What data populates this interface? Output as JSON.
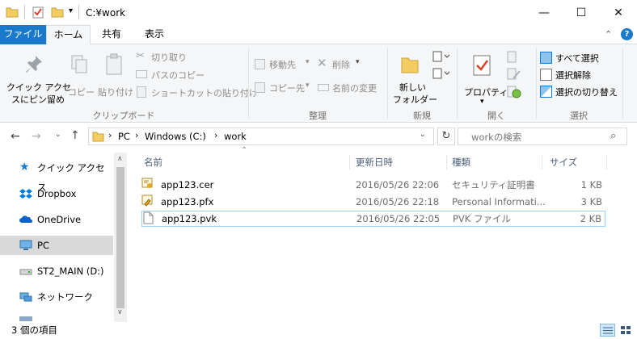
{
  "window": {
    "title": "C:¥work",
    "minimize": "—",
    "maximize": "☐",
    "close": "✕"
  },
  "tabs": {
    "file": "ファイル",
    "home": "ホーム",
    "share": "共有",
    "view": "表示"
  },
  "ribbon": {
    "quick_access": "クイック アクセ\nスにピン留め",
    "quick_access_l1": "クイック アクセ",
    "quick_access_l2": "スにピン留め",
    "copy": "コピー",
    "paste": "貼り付け",
    "cut": "切り取り",
    "copy_path": "パスのコピー",
    "paste_shortcut": "ショートカットの貼り付け",
    "clipboard_group": "クリップボード",
    "move_to": "移動先",
    "copy_to": "コピー先",
    "delete": "削除",
    "rename": "名前の変更",
    "organize_group": "整理",
    "new_folder_l1": "新しい",
    "new_folder_l2": "フォルダー",
    "new_group": "新規",
    "properties": "プロパティ",
    "open_group": "開く",
    "select_all": "すべて選択",
    "select_none": "選択解除",
    "invert_selection": "選択の切り替え",
    "select_group": "選択"
  },
  "address": {
    "crumbs": [
      "PC",
      "Windows (C:)",
      "work"
    ],
    "search_placeholder": "workの検索"
  },
  "nav": {
    "items": [
      {
        "label": "クイック アクセス",
        "icon": "star-icon"
      },
      {
        "label": "Dropbox",
        "icon": "dropbox-icon"
      },
      {
        "label": "OneDrive",
        "icon": "cloud-icon"
      },
      {
        "label": "PC",
        "icon": "computer-icon"
      },
      {
        "label": "ST2_MAIN (D:)",
        "icon": "drive-icon"
      },
      {
        "label": "ネットワーク",
        "icon": "network-icon"
      }
    ]
  },
  "columns": {
    "name": "名前",
    "modified": "更新日時",
    "type": "種類",
    "size": "サイズ"
  },
  "files": [
    {
      "name": "app123.cer",
      "modified": "2016/05/26 22:06",
      "type": "セキュリティ証明書",
      "size": "1 KB",
      "icon": "certificate-icon"
    },
    {
      "name": "app123.pfx",
      "modified": "2016/05/26 22:18",
      "type": "Personal Informati...",
      "size": "3 KB",
      "icon": "pfx-icon"
    },
    {
      "name": "app123.pvk",
      "modified": "2016/05/26 22:05",
      "type": "PVK ファイル",
      "size": "2 KB",
      "icon": "file-icon"
    }
  ],
  "status": {
    "count": "3 個の項目"
  },
  "colors": {
    "accent": "#1979ca",
    "selection": "#cce8ff",
    "folder": "#f3cd62"
  }
}
